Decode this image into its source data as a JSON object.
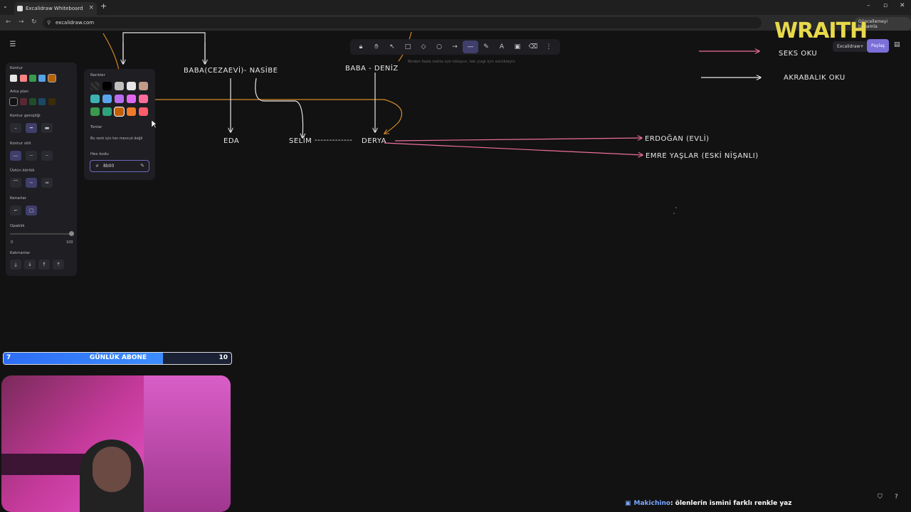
{
  "browser": {
    "tab_title": "Excalidraw Whiteboard",
    "url": "excalidraw.com",
    "update_button": "Güncellemeyi tamamla"
  },
  "toolbar": {
    "tools": [
      "lock-icon",
      "hand-icon",
      "select-icon",
      "rectangle-icon",
      "diamond-icon",
      "ellipse-icon",
      "arrow-icon",
      "line-icon",
      "pencil-icon",
      "text-icon",
      "image-icon",
      "eraser-icon",
      "more-icon"
    ],
    "hint": "Birden fazla nokta için tıklayın, tek çizgi için sürükleyin",
    "library_label": "Excalidraw+",
    "share_label": "Paylaş"
  },
  "properties": {
    "stroke_label": "Kontur",
    "background_label": "Arka plan",
    "stroke_width_label": "Kontur genişliği",
    "stroke_style_label": "Kontur stili",
    "sloppiness_label": "Üstün körlük",
    "edges_label": "Kenarlar",
    "opacity_label": "Opaklık",
    "opacity_min": "0",
    "opacity_max": "100",
    "layers_label": "Katmanlar",
    "stroke_colors": [
      "#e6e6e6",
      "#ff8383",
      "#3a994c",
      "#56a2e8",
      "#b76100"
    ],
    "background_colors": [
      "#121212",
      "#5a2834",
      "#1f4d2b",
      "#1b4866",
      "#3b2c0a"
    ]
  },
  "color_picker": {
    "colors_label": "Renkler",
    "shades_label": "Tonlar",
    "no_shades_text": "Bu renk için ton mevcut değil",
    "hex_label": "Hex kodu",
    "hex_value": "8b00",
    "swatches": [
      [
        "transparent",
        "#000000",
        "#bfbfbf",
        "#e6e6e6",
        "#c49a88"
      ],
      [
        "#3eb2b2",
        "#5aa4ed",
        "#b86cf0",
        "#e066f0",
        "#ff6b9b"
      ],
      [
        "#3a994c",
        "#2ea27a",
        "#c25f00",
        "#f07a2a",
        "#ff5c6c"
      ]
    ]
  },
  "diagram": {
    "labels": {
      "baba_cezaevi": "BABA(CEZAEVİ)- NASİBE",
      "baba_deniz": "BABA - DENİZ",
      "eda": "EDA",
      "selim": "SELİM",
      "dashes": "-------------",
      "derya": "DERYA",
      "erdogan": "ERDOĞAN (EVLİ)",
      "emre": "EMRE YAŞLAR (ESKİ NİŞANLI)",
      "seks_oku": "SEKS OKU",
      "akrabalik_oku": "AKRABALIK OKU"
    },
    "colors": {
      "white": "#e8e8e8",
      "pink": "#ee6fa0",
      "orange": "#d48a2a"
    }
  },
  "overlay": {
    "brand": "WRAITH",
    "sub_goal_current": "7",
    "sub_goal_label": "GÜNLÜK ABONE",
    "sub_goal_target": "10",
    "chat_user": "Makichino",
    "chat_message": ": ölenlerin ismini farklı renkle yaz"
  }
}
